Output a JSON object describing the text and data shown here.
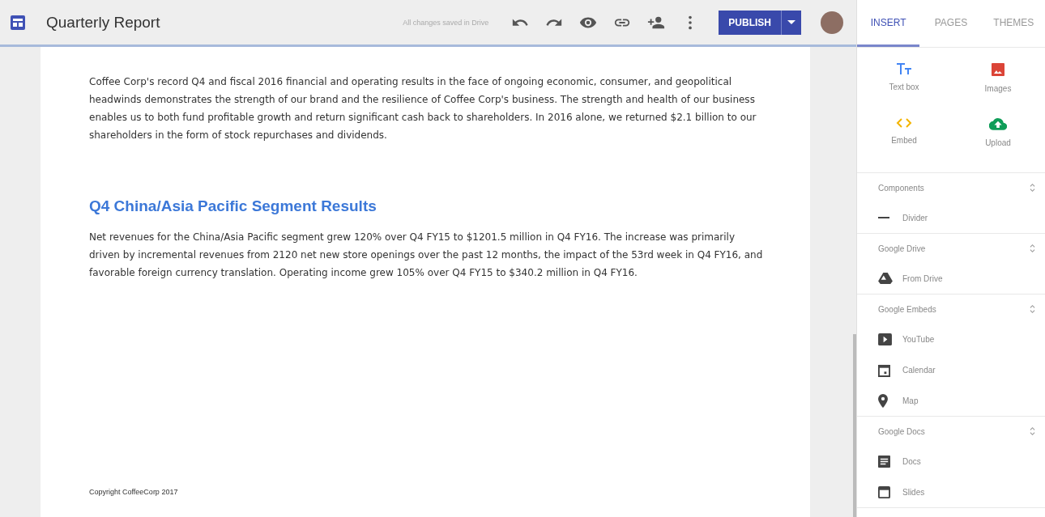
{
  "app_bar": {
    "title": "Quarterly Report",
    "save_status": "All changes saved in Drive",
    "publish_label": "PUBLISH"
  },
  "document": {
    "sections": [
      {
        "body": "Coffee Corp's record Q4 and fiscal 2016 financial and operating results in the face of ongoing economic, consumer, and geopolitical headwinds demonstrates the strength of our brand and the resilience of Coffee Corp's business. The strength and health of our business enables us to both fund profitable growth and return significant cash back to shareholders. In 2016 alone, we returned $2.1 billion to our shareholders in the form of stock repurchases and dividends."
      },
      {
        "heading": "Q4 China/Asia Pacific Segment Results",
        "body": "Net revenues for the China/Asia Pacific segment grew 120% over Q4 FY15 to $1201.5 million in Q4 FY16. The increase was primarily driven by incremental revenues from 2120 net new store openings over the past 12 months, the impact of the 53rd week in Q4 FY16, and favorable foreign currency translation. Operating income grew 105% over Q4 FY15 to $340.2 million in Q4 FY16."
      }
    ],
    "footer": "Copyright CoffeeCorp 2017"
  },
  "panel": {
    "tabs": [
      {
        "label": "INSERT",
        "selected": true
      },
      {
        "label": "PAGES",
        "selected": false
      },
      {
        "label": "THEMES",
        "selected": false
      }
    ],
    "tiles": [
      {
        "label": "Text box",
        "kind": "textbox"
      },
      {
        "label": "Images",
        "kind": "image"
      },
      {
        "label": "Embed",
        "kind": "embed"
      },
      {
        "label": "Upload",
        "kind": "upload"
      }
    ],
    "groups": [
      {
        "title": "Components",
        "items": [
          {
            "label": "Divider",
            "kind": "divider"
          }
        ]
      },
      {
        "title": "Google Drive",
        "items": [
          {
            "label": "From Drive",
            "kind": "drive"
          }
        ]
      },
      {
        "title": "Google Embeds",
        "items": [
          {
            "label": "YouTube",
            "kind": "video"
          },
          {
            "label": "Calendar",
            "kind": "calendar"
          },
          {
            "label": "Map",
            "kind": "map"
          }
        ]
      },
      {
        "title": "Google Docs",
        "items": [
          {
            "label": "Docs",
            "kind": "docs"
          },
          {
            "label": "Slides",
            "kind": "slides"
          }
        ]
      }
    ]
  }
}
